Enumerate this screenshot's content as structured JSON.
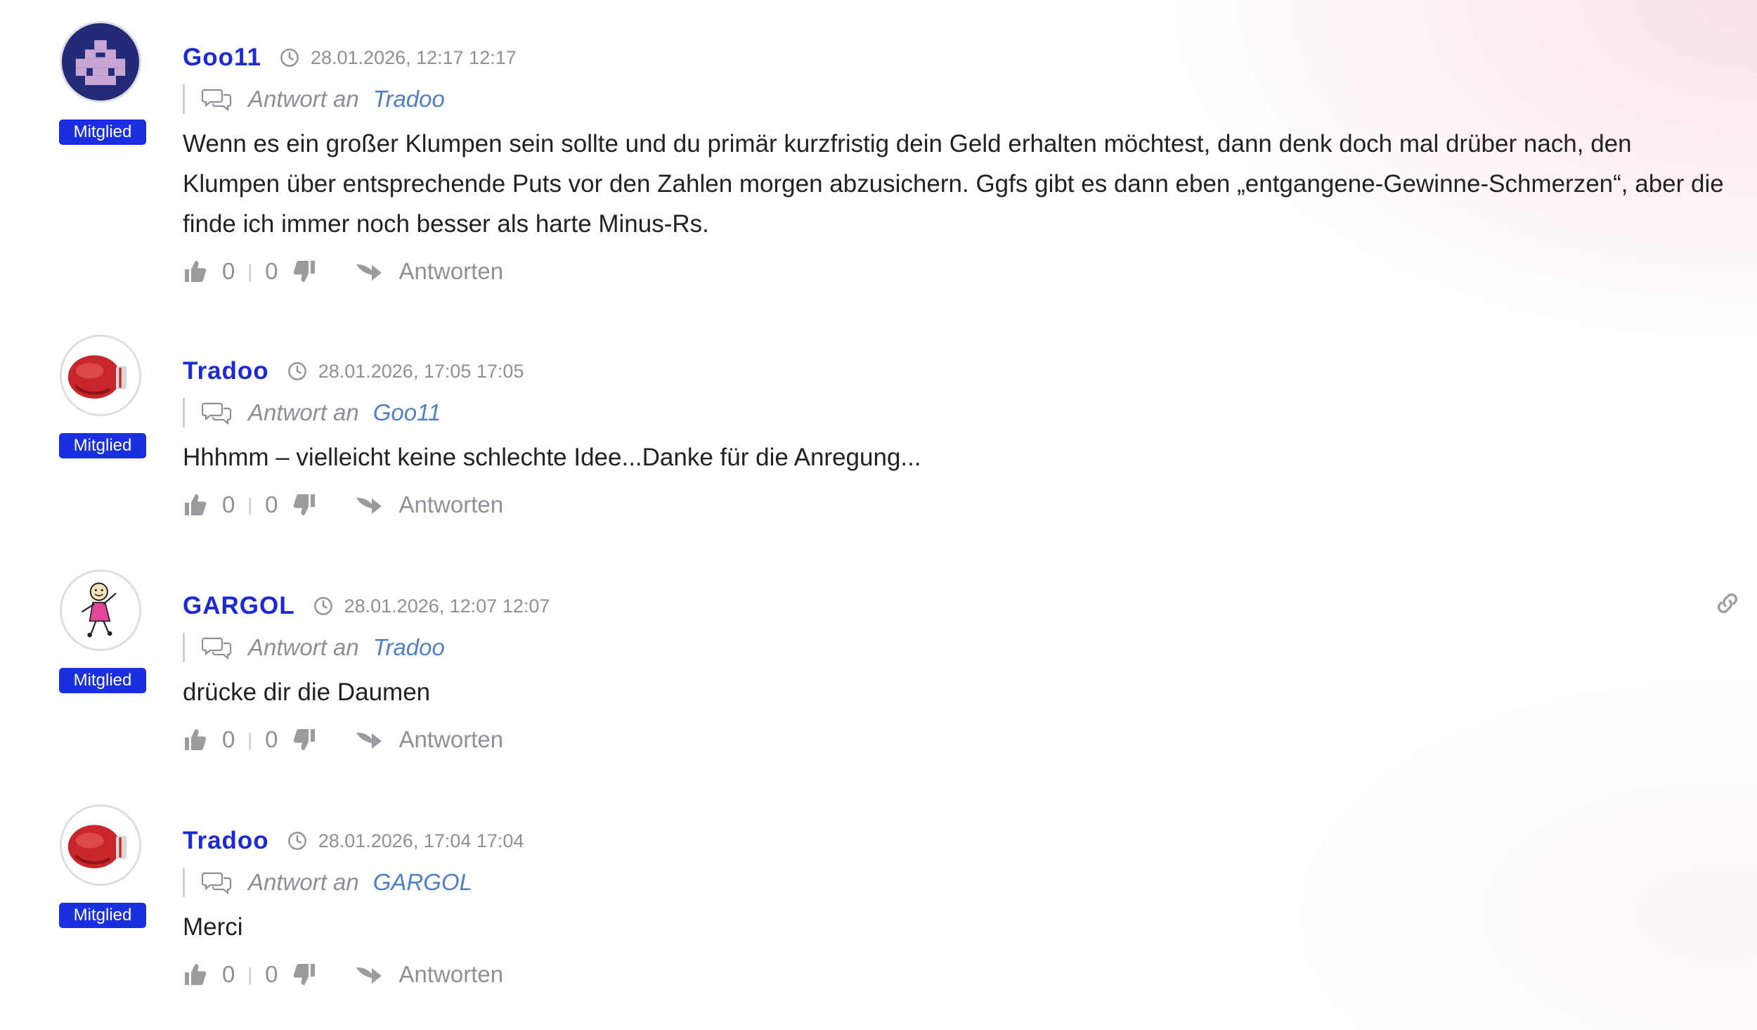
{
  "comments": [
    {
      "author": "Goo11",
      "date": "28.01.2026, 12:17 12:17",
      "badge": "Mitglied",
      "reply_label": "Antwort an",
      "reply_to": "Tradoo",
      "text": "Wenn es ein großer Klumpen sein sollte und du primär kurzfristig dein Geld erhalten möchtest, dann denk doch mal drüber nach, den Klumpen über entsprechende Puts vor den Zahlen morgen abzusichern. Ggfs gibt es dann eben „entgangene-Gewinne-Schmerzen“, aber die finde ich immer noch besser als harte Minus-Rs.",
      "likes": "0",
      "dislikes": "0",
      "reply_button": "Antworten",
      "avatar": "pixel-avatar"
    },
    {
      "author": "Tradoo",
      "date": "28.01.2026, 17:05 17:05",
      "badge": "Mitglied",
      "reply_label": "Antwort an",
      "reply_to": "Goo11",
      "text": "Hhhmm – vielleicht keine schlechte Idee...Danke für die Anregung...",
      "likes": "0",
      "dislikes": "0",
      "reply_button": "Antworten",
      "avatar": "boxing-glove"
    },
    {
      "author": "GARGOL",
      "date": "28.01.2026, 12:07 12:07",
      "badge": "Mitglied",
      "reply_label": "Antwort an",
      "reply_to": "Tradoo",
      "text": "drücke dir die Daumen",
      "likes": "0",
      "dislikes": "0",
      "reply_button": "Antworten",
      "avatar": "stick-figure"
    },
    {
      "author": "Tradoo",
      "date": "28.01.2026, 17:04 17:04",
      "badge": "Mitglied",
      "reply_label": "Antwort an",
      "reply_to": "GARGOL",
      "text": "Merci",
      "likes": "0",
      "dislikes": "0",
      "reply_button": "Antworten",
      "avatar": "boxing-glove"
    }
  ],
  "colors": {
    "author": "#1b2ad6",
    "badge_bg": "#1a2fe0",
    "reply_user": "#4f7fc6",
    "muted": "#8f8f95"
  },
  "icons": [
    "clock-icon",
    "chat-bubbles-icon",
    "thumbs-up-icon",
    "thumbs-down-icon",
    "reply-arrow-icon",
    "link-icon"
  ]
}
